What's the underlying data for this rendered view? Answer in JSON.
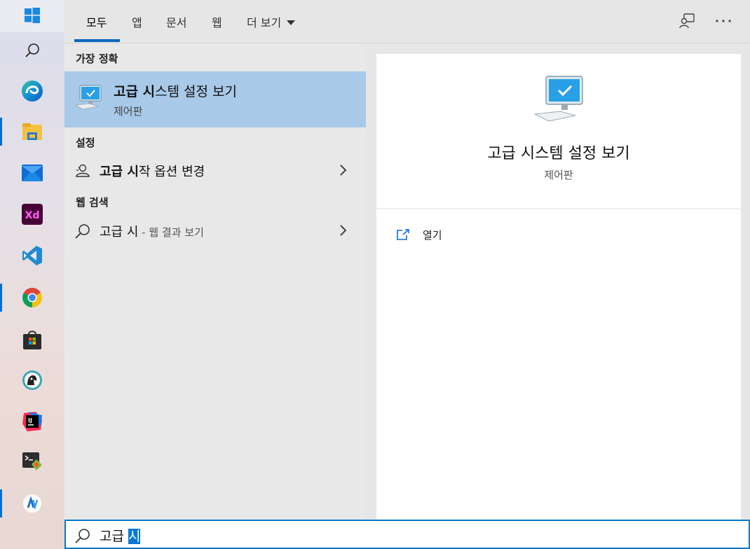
{
  "tabs": [
    {
      "label": "모두",
      "active": true
    },
    {
      "label": "앱"
    },
    {
      "label": "문서"
    },
    {
      "label": "웹"
    },
    {
      "label": "더 보기"
    }
  ],
  "topbar_icons": [
    "feedback-icon",
    "more-icon"
  ],
  "rail_apps": [
    "windows-start-icon",
    "search-icon",
    "edge-icon",
    "file-explorer-icon",
    "mail-icon",
    "adobe-xd-icon",
    "vscode-icon",
    "chrome-icon",
    "store-icon",
    "app-icon",
    "intellij-icon",
    "terminal-app-icon",
    "app-icon-2"
  ],
  "results": {
    "best_match_label": "가장 정확",
    "best_match": {
      "title_bold": "고급 시",
      "title_rest": "스템 설정 보기",
      "subtitle": "제어판"
    },
    "settings_label": "설정",
    "settings_item": {
      "bold": "고급 시",
      "rest": "작 옵션 변경"
    },
    "web_label": "웹 검색",
    "web_item": {
      "query": "고급 시",
      "suffix": " - 웹 결과 보기"
    }
  },
  "preview": {
    "title": "고급 시스템 설정 보기",
    "subtitle": "제어판",
    "open_label": "열기"
  },
  "search": {
    "text": "고급 ",
    "selected": "시"
  },
  "colors": {
    "accent": "#0067c0",
    "highlight": "#a8c9e8"
  }
}
